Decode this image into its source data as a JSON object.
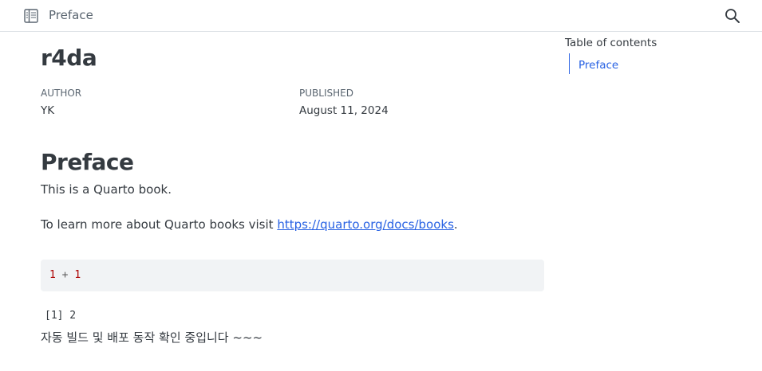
{
  "topbar": {
    "breadcrumb": "Preface",
    "sidebar_toggle_icon": "sidebar-toggle-icon",
    "search_icon": "search-icon"
  },
  "header": {
    "title": "r4da",
    "author_label": "AUTHOR",
    "author": "YK",
    "published_label": "PUBLISHED",
    "published": "August 11, 2024"
  },
  "main": {
    "heading": "Preface",
    "para1": "This is a Quarto book.",
    "para2_prefix": "To learn more about Quarto books visit ",
    "para2_link": "https://quarto.org/docs/books",
    "para2_suffix": ".",
    "code": {
      "left": "1",
      "op": "+",
      "right": "1"
    },
    "output": "[1] 2",
    "korean_text": "자동 빌드 및 배포 동작 확인 중입니다 ~~~"
  },
  "toc": {
    "title": "Table of contents",
    "items": [
      {
        "label": "Preface"
      }
    ]
  },
  "colors": {
    "link": "#2761e3",
    "text": "#343a40",
    "muted": "#5a6570",
    "code_bg": "#f1f3f5",
    "code_number": "#ad0000"
  }
}
